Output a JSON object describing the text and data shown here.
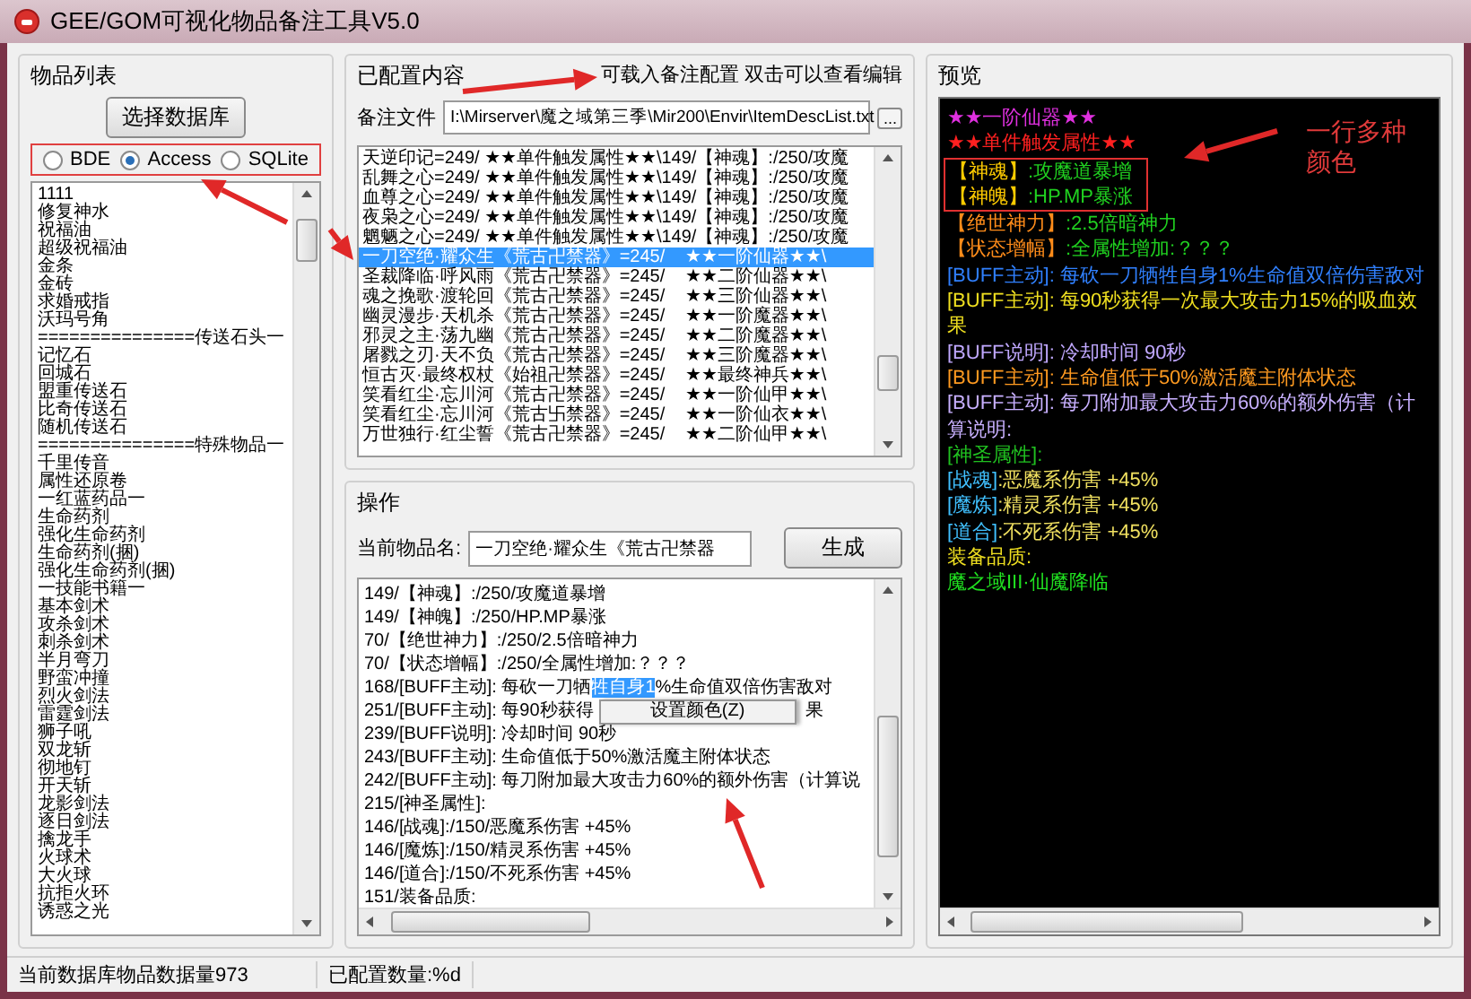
{
  "window": {
    "title": "GEE/GOM可视化物品备注工具V5.0"
  },
  "item_list": {
    "title": "物品列表",
    "button": "选择数据库",
    "highlighted": true,
    "database_options": [
      {
        "label": "BDE",
        "selected": false
      },
      {
        "label": "Access",
        "selected": true
      },
      {
        "label": "SQLite",
        "selected": false
      }
    ],
    "items": [
      "1111",
      "修复神水",
      "祝福油",
      "超级祝福油",
      "金条",
      "金砖",
      "求婚戒指",
      "沃玛号角",
      "===============传送石头一",
      "记忆石",
      "回城石",
      "盟重传送石",
      "比奇传送石",
      "随机传送石",
      "===============特殊物品一",
      "千里传音",
      "属性还原卷",
      "一红蓝药品一",
      "生命药剂",
      "强化生命药剂",
      "生命药剂(捆)",
      "强化生命药剂(捆)",
      "一技能书籍一",
      "基本剑术",
      "攻杀剑术",
      "刺杀剑术",
      "半月弯刀",
      "野蛮冲撞",
      "烈火剑法",
      "雷霆剑法",
      "狮子吼",
      "双龙斩",
      "彻地钉",
      "开天斩",
      "龙影剑法",
      "逐日剑法",
      "擒龙手",
      "火球术",
      "大火球",
      "抗拒火环",
      "诱惑之光"
    ]
  },
  "configured": {
    "title": "已配置内容",
    "hint": "可载入备注配置 双击可以查看编辑",
    "file_label": "备注文件",
    "file_path": "I:\\Mirserver\\魔之域第三季\\Mir200\\Envir\\ItemDescList.txt",
    "browse_button": "...",
    "rows": [
      {
        "name": "天逆印记=249/ ★★单件触发属性★★\\149/【神魂】:/250/攻魔",
        "selected": false
      },
      {
        "name": "乱舞之心=249/ ★★单件触发属性★★\\149/【神魂】:/250/攻魔",
        "selected": false
      },
      {
        "name": "血尊之心=249/ ★★单件触发属性★★\\149/【神魂】:/250/攻魔",
        "selected": false
      },
      {
        "name": "夜枭之心=249/ ★★单件触发属性★★\\149/【神魂】:/250/攻魔",
        "selected": false
      },
      {
        "name": "魍魉之心=249/ ★★单件触发属性★★\\149/【神魂】:/250/攻魔",
        "selected": false
      },
      {
        "name": "一刀空绝·耀众生《荒古卍禁器》=245/",
        "detail": "★★一阶仙器★★\\",
        "selected": true
      },
      {
        "name": "圣裁降临·呼风雨《荒古卍禁器》=245/",
        "detail": "★★二阶仙器★★\\",
        "selected": false
      },
      {
        "name": "魂之挽歌·渡轮回《荒古卍禁器》=245/",
        "detail": "★★三阶仙器★★\\",
        "selected": false
      },
      {
        "name": "幽灵漫步·天机杀《荒古卍禁器》=245/",
        "detail": "★★一阶魔器★★\\",
        "selected": false
      },
      {
        "name": "邪灵之主·荡九幽《荒古卍禁器》=245/",
        "detail": "★★二阶魔器★★\\",
        "selected": false
      },
      {
        "name": "屠戮之刃·天不负《荒古卍禁器》=245/",
        "detail": "★★三阶魔器★★\\",
        "selected": false
      },
      {
        "name": "恒古灭·最终权杖《始祖卍禁器》=245/",
        "detail": "★★最终神兵★★\\",
        "selected": false
      },
      {
        "name": "笑看红尘·忘川河《荒古卍禁器》=245/",
        "detail": "★★一阶仙甲★★\\",
        "selected": false
      },
      {
        "name": "笑看红尘·忘川河《荒古卐禁器》=245/",
        "detail": "★★一阶仙衣★★\\",
        "selected": false
      },
      {
        "name": "万世独行·红尘誓《荒古卍禁器》=245/",
        "detail": "★★二阶仙甲★★\\",
        "selected": false
      }
    ]
  },
  "operation": {
    "title": "操作",
    "name_label": "当前物品名:",
    "name_value": "一刀空绝·耀众生《荒古卍禁器",
    "generate_button": "生成",
    "lines": [
      {
        "kind": "plain",
        "text": "149/【神魂】:/250/攻魔道暴增"
      },
      {
        "kind": "plain",
        "text": "149/【神魄】:/250/HP.MP暴涨"
      },
      {
        "kind": "plain",
        "text": "70/【绝世神力】:/250/2.5倍暗神力"
      },
      {
        "kind": "plain",
        "text": "70/【状态增幅】:/250/全属性增加:？？？"
      },
      {
        "kind": "selection",
        "text": "168/[BUFF主动]: 每砍一刀牺",
        "selected_text": "牲自身1",
        "after": "%生命值双倍伤害敌对"
      },
      {
        "kind": "covered",
        "text": "251/[BUFF主动]: 每90秒获得",
        "after": "果"
      },
      {
        "kind": "plain",
        "text": "239/[BUFF说明]: 冷却时间 90秒"
      },
      {
        "kind": "plain",
        "text": "243/[BUFF主动]: 生命值低于50%激活魔主附体状态"
      },
      {
        "kind": "plain",
        "text": "242/[BUFF主动]: 每刀附加最大攻击力60%的额外伤害（计算说"
      },
      {
        "kind": "plain",
        "text": "215/[神圣属性]:"
      },
      {
        "kind": "plain",
        "text": "146/[战魂]:/150/恶魔系伤害 +45%"
      },
      {
        "kind": "plain",
        "text": "146/[魔炼]:/150/精灵系伤害 +45%"
      },
      {
        "kind": "plain",
        "text": "146/[道合]:/150/不死系伤害 +45%"
      },
      {
        "kind": "plain",
        "text": "151/装备品质:"
      }
    ],
    "context_menu": {
      "items": [
        "设置颜色(Z)"
      ]
    }
  },
  "preview": {
    "title": "预览",
    "note": "一行多种颜色",
    "lines": [
      {
        "boxed": false,
        "segments": [
          {
            "text": "★★一阶仙器★★",
            "color": "#e030e0"
          }
        ]
      },
      {
        "boxed": false,
        "segments": [
          {
            "text": "★★单件触发属性★★",
            "color": "#ff2020"
          }
        ]
      },
      {
        "boxed": true,
        "segments": [
          {
            "text": "【神魂】",
            "color": "#ffcc00"
          },
          {
            "text": ":攻魔道暴增",
            "color": "#20d020"
          }
        ]
      },
      {
        "boxed": true,
        "segments": [
          {
            "text": "【神魄】",
            "color": "#ffcc00"
          },
          {
            "text": ":HP.MP暴涨",
            "color": "#20d020"
          }
        ]
      },
      {
        "boxed": false,
        "segments": [
          {
            "text": "【绝世神力】",
            "color": "#ff8c1a"
          },
          {
            "text": ":2.5倍暗神力",
            "color": "#20d020"
          }
        ]
      },
      {
        "boxed": false,
        "segments": [
          {
            "text": "【状态增幅】",
            "color": "#ff8c1a"
          },
          {
            "text": ":全属性增加:？？？",
            "color": "#20d020"
          }
        ]
      },
      {
        "boxed": false,
        "segments": [
          {
            "text": "[BUFF主动]: 每砍一刀牺牲自身1%生命值双倍伤害敌对",
            "color": "#3080ff"
          }
        ]
      },
      {
        "boxed": false,
        "segments": [
          {
            "text": "[BUFF主动]: 每90秒获得一次最大攻击力15%的吸血效果",
            "color": "#f0e020"
          }
        ]
      },
      {
        "boxed": false,
        "segments": [
          {
            "text": "[BUFF说明]: 冷却时间 90秒",
            "color": "#c0a8ff"
          }
        ]
      },
      {
        "boxed": false,
        "segments": [
          {
            "text": "[BUFF主动]: 生命值低于50%激活魔主附体状态",
            "color": "#ff9a20"
          }
        ]
      },
      {
        "boxed": false,
        "segments": [
          {
            "text": "[BUFF主动]: 每刀附加最大攻击力60%的额外伤害（计算说明:",
            "color": "#c8b0ff"
          }
        ]
      },
      {
        "boxed": false,
        "segments": [
          {
            "text": "[神圣属性]:",
            "color": "#20c020"
          }
        ]
      },
      {
        "boxed": false,
        "segments": [
          {
            "text": "[战魂]",
            "color": "#40c0ff"
          },
          {
            "text": ":恶魔系伤害 +45%",
            "color": "#f0e060"
          }
        ]
      },
      {
        "boxed": false,
        "segments": [
          {
            "text": "[魔炼]",
            "color": "#40c0ff"
          },
          {
            "text": ":精灵系伤害 +45%",
            "color": "#f0e060"
          }
        ]
      },
      {
        "boxed": false,
        "segments": [
          {
            "text": "[道合]",
            "color": "#40c0ff"
          },
          {
            "text": ":不死系伤害 +45%",
            "color": "#f0e060"
          }
        ]
      },
      {
        "boxed": false,
        "segments": [
          {
            "text": "装备品质:",
            "color": "#f0e020"
          }
        ]
      },
      {
        "boxed": false,
        "segments": [
          {
            "text": "魔之域III·仙魔降临",
            "color": "#20e020"
          }
        ]
      }
    ]
  },
  "status_bar": {
    "item_count": "当前数据库物品数据量973",
    "configured_count": "已配置数量:%d"
  }
}
